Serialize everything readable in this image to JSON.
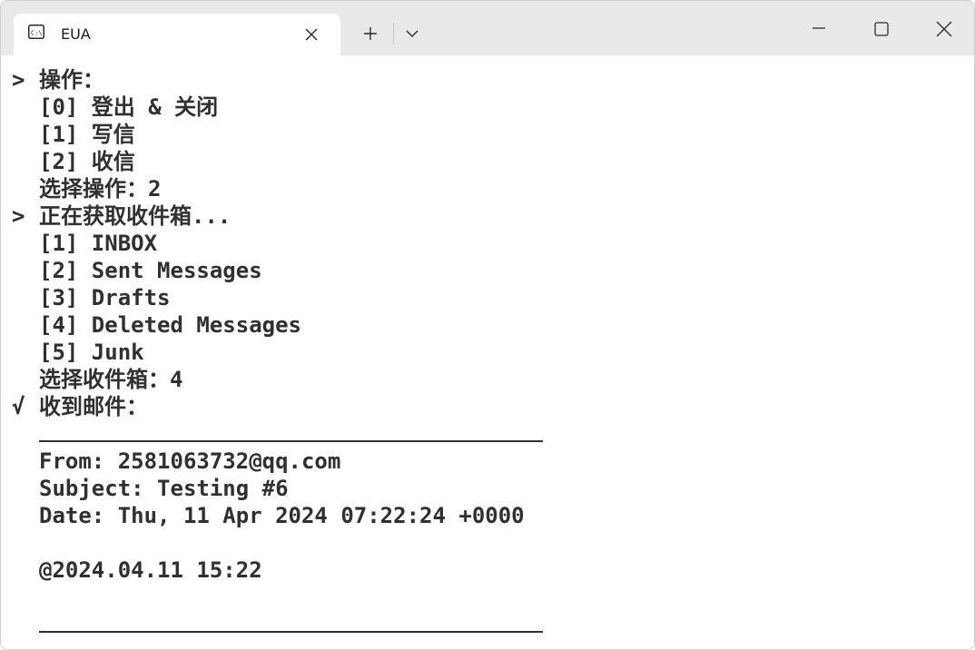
{
  "tab": {
    "title": "EUA",
    "icon": "terminal-icon"
  },
  "titlebar": {
    "new_tab_icon": "plus-icon",
    "dropdown_icon": "chevron-down-icon",
    "minimize_icon": "minimize-icon",
    "maximize_icon": "maximize-icon",
    "close_icon": "close-icon"
  },
  "terminal": {
    "prompt_symbol": ">",
    "check_symbol": "√",
    "lines": [
      "操作：",
      "[0] 登出 & 关闭",
      "[1] 写信",
      "[2] 收信",
      "选择操作：2",
      "正在获取收件箱...",
      "[1] INBOX",
      "[2] Sent Messages",
      "[3] Drafts",
      "[4] Deleted Messages",
      "[5] Junk",
      "选择收件箱：4",
      "收到邮件：",
      "From: 2581063732@qq.com",
      "Subject: Testing #6",
      "Date: Thu, 11 Apr 2024 07:22:24 +0000",
      "@2024.04.11 15:22"
    ]
  },
  "colors": {
    "titlebar_bg": "#e9e9e9",
    "tab_bg": "#ffffff",
    "text": "#303030"
  }
}
